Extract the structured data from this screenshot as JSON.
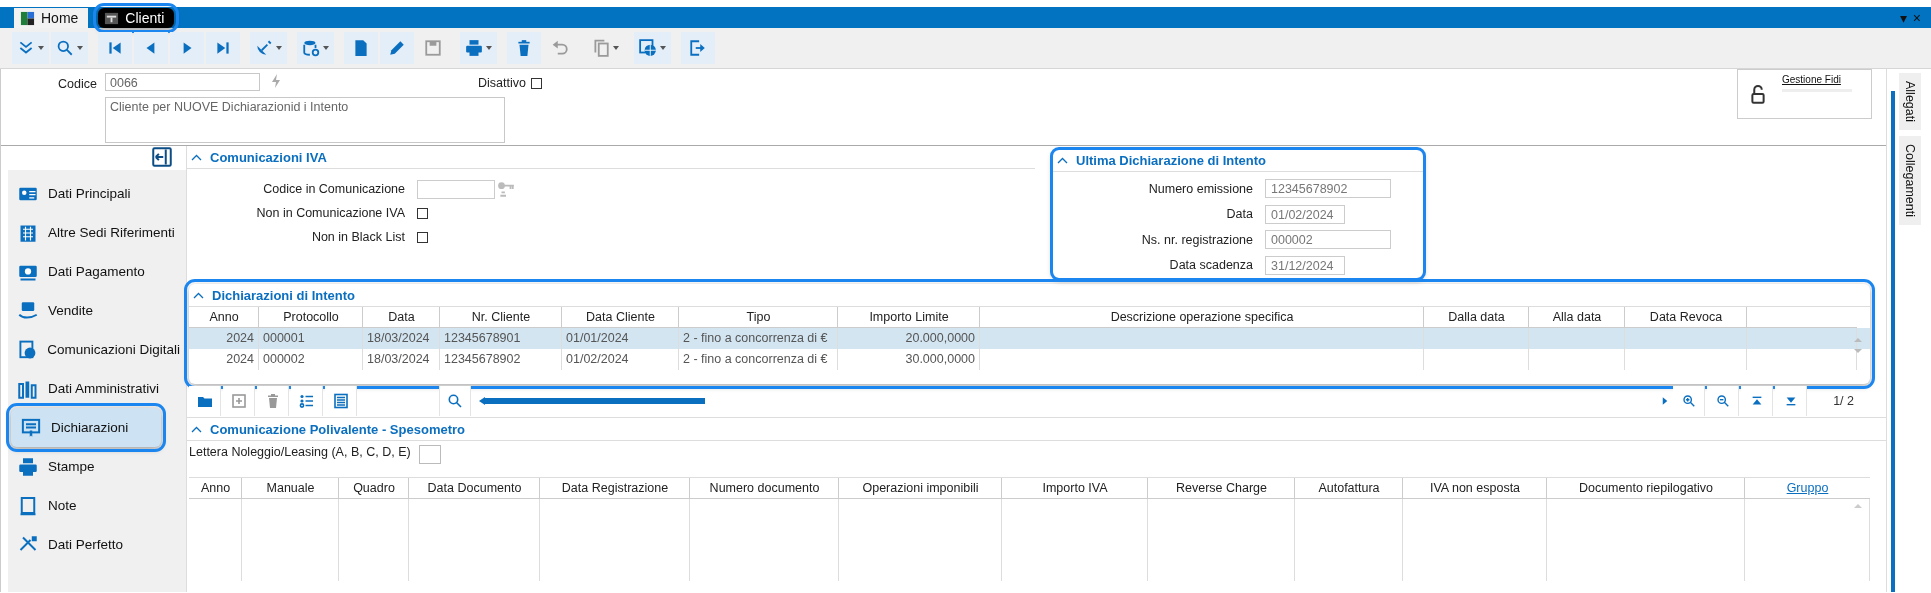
{
  "tabs": [
    {
      "label": "Home",
      "selected": false,
      "highlighted": false
    },
    {
      "label": "Clienti",
      "selected": true,
      "highlighted": true
    }
  ],
  "window_buttons": [
    "▾",
    "×"
  ],
  "toolbar": [
    [
      {
        "disabled": false
      },
      {
        "disabled": false
      }
    ],
    [
      {
        "disabled": false
      },
      {
        "disabled": false
      },
      {
        "disabled": false
      },
      {
        "disabled": false
      }
    ],
    [
      {
        "disabled": false
      }
    ],
    [
      {
        "disabled": false
      }
    ],
    [
      {
        "disabled": false
      },
      {
        "disabled": false
      },
      {
        "disabled": true
      }
    ],
    [
      {
        "disabled": false
      }
    ],
    [
      {
        "disabled": false
      },
      {
        "disabled": true
      }
    ],
    [
      {
        "disabled": true
      }
    ],
    [
      {
        "disabled": false
      }
    ],
    [
      {
        "disabled": false
      }
    ]
  ],
  "header": {
    "codice_label": "Codice",
    "codice_value": "0066",
    "description": "Cliente per NUOVE Dichiarazionid i Intento",
    "disattivo_label": "Disattivo",
    "disattivo_checked": false,
    "gestione_fidi": "Gestione Fidi"
  },
  "side_tabs": [
    "Allegati",
    "Collegamenti"
  ],
  "sidebar": [
    {
      "label": "Dati Principali",
      "selected": false,
      "highlighted": false
    },
    {
      "label": "Altre Sedi Riferimenti",
      "selected": false,
      "highlighted": false
    },
    {
      "label": "Dati Pagamento",
      "selected": false,
      "highlighted": false
    },
    {
      "label": "Vendite",
      "selected": false,
      "highlighted": false
    },
    {
      "label": "Comunicazioni Digitali",
      "selected": false,
      "highlighted": false
    },
    {
      "label": "Dati Amministrativi",
      "selected": false,
      "highlighted": false
    },
    {
      "label": "Dichiarazioni",
      "selected": true,
      "highlighted": true
    },
    {
      "label": "Stampe",
      "selected": false,
      "highlighted": false
    },
    {
      "label": "Note",
      "selected": false,
      "highlighted": false
    },
    {
      "label": "Dati Perfetto",
      "selected": false,
      "highlighted": false
    }
  ],
  "comunicazioni_iva": {
    "title": "Comunicazioni IVA",
    "expanded": true,
    "fields": [
      {
        "kind": "text",
        "label": "Codice in Comunicazione"
      },
      {
        "kind": "checkbox",
        "label": "Non in Comunicazione IVA",
        "checked": false
      },
      {
        "kind": "checkbox",
        "label": "Non in Black List",
        "checked": false
      }
    ]
  },
  "ultima_dichiarazione": {
    "title": "Ultima Dichiarazione di Intento",
    "expanded": true,
    "highlighted": true,
    "fields": [
      {
        "kind": "text",
        "label": "Numero emissione",
        "value": "12345678902"
      },
      {
        "kind": "date",
        "label": "Data",
        "value": "01/02/2024"
      },
      {
        "kind": "text",
        "label": "Ns. nr. registrazione",
        "value": "000002"
      },
      {
        "kind": "date",
        "label": "Data scadenza",
        "value": "31/12/2024"
      }
    ]
  },
  "dichiarazioni_intento": {
    "title": "Dichiarazioni di Intento",
    "expanded": true,
    "highlighted": true,
    "columns": [
      "Anno",
      "Protocollo",
      "Data",
      "Nr. Cliente",
      "Data Cliente",
      "Tipo",
      "Importo Limite",
      "Descrizione operazione specifica",
      "Dalla data",
      "Alla data",
      "Data Revoca"
    ],
    "rows": [
      {
        "selected": true,
        "cells": [
          "2024",
          "000001",
          "18/03/2024",
          "12345678901",
          "01/01/2024",
          "2 - fino a concorrenza di €",
          "20.000,0000"
        ]
      },
      {
        "selected": false,
        "cells": [
          "2024",
          "000002",
          "18/03/2024",
          "12345678902",
          "01/02/2024",
          "2 - fino a concorrenza di €",
          "30.000,0000"
        ]
      }
    ],
    "tools": [
      {
        "disabled": false
      },
      {
        "disabled": true
      },
      {
        "disabled": true
      },
      {
        "disabled": false
      },
      {
        "disabled": false
      },
      {
        "disabled": false
      }
    ],
    "pager": "1/  2"
  },
  "polivalente": {
    "title": "Comunicazione Polivalente - Spesometro",
    "expanded": true,
    "lettera_label": "Lettera Noleggio/Leasing (A, B, C, D, E)",
    "columns": [
      {
        "label": "Anno",
        "kind": "text"
      },
      {
        "label": "Manuale",
        "kind": "text"
      },
      {
        "label": "Quadro",
        "kind": "text"
      },
      {
        "label": "Data Documento",
        "kind": "text"
      },
      {
        "label": "Data Registrazione",
        "kind": "text"
      },
      {
        "label": "Numero documento",
        "kind": "text"
      },
      {
        "label": "Operazioni imponibili",
        "kind": "text"
      },
      {
        "label": "Importo IVA",
        "kind": "text"
      },
      {
        "label": "Reverse Charge",
        "kind": "text"
      },
      {
        "label": "Autofattura",
        "kind": "text"
      },
      {
        "label": "IVA non esposta",
        "kind": "text"
      },
      {
        "label": "Documento riepilogativo",
        "kind": "text"
      },
      {
        "label": "Gruppo",
        "kind": "link"
      }
    ]
  }
}
